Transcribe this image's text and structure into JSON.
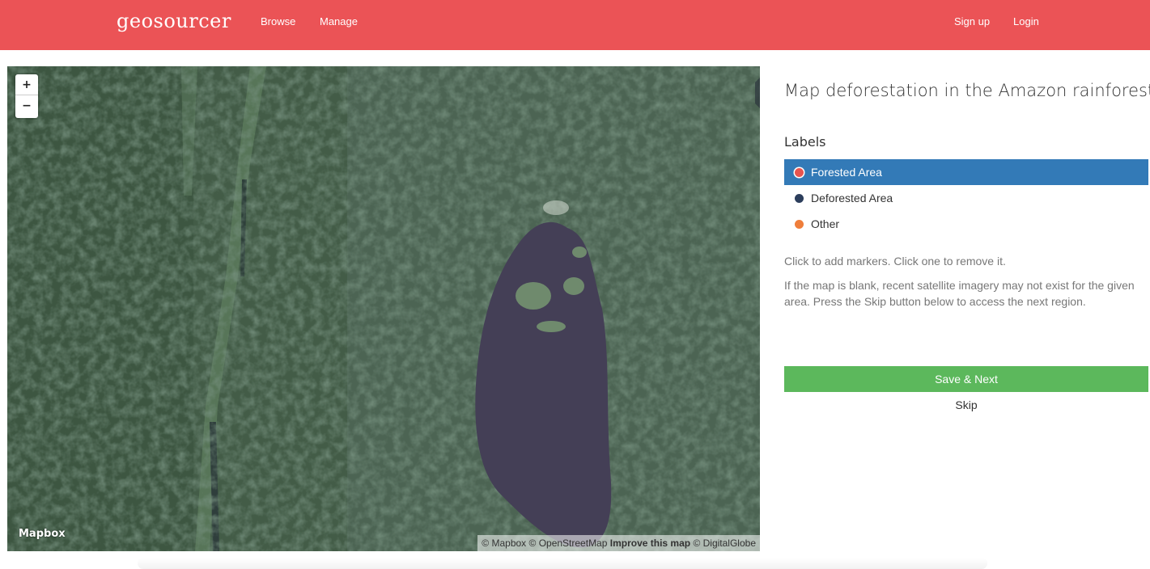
{
  "navbar": {
    "brand": "geosourcer",
    "left_links": [
      "Browse",
      "Manage"
    ],
    "right_links": [
      "Sign up",
      "Login"
    ],
    "color": "#eb5356"
  },
  "map": {
    "zoom_in": "+",
    "zoom_out": "−",
    "logo": "Mapbox",
    "attribution": {
      "mapbox": "© Mapbox",
      "osm": "© OpenStreetMap",
      "improve": "Improve this map",
      "digitalglobe": "© DigitalGlobe"
    }
  },
  "panel": {
    "title": "Map deforestation in the Amazon rainforest",
    "labels_heading": "Labels",
    "labels": [
      {
        "label": "Forested Area",
        "color": "#e8544f",
        "selected": true
      },
      {
        "label": "Deforested Area",
        "color": "#2c3e5c",
        "selected": false
      },
      {
        "label": "Other",
        "color": "#ef7e3b",
        "selected": false
      }
    ],
    "help_1": "Click to add markers. Click one to remove it.",
    "help_2": "If the map is blank, recent satellite imagery may not exist for the given area. Press the Skip button below to access the next region.",
    "save_label": "Save & Next",
    "skip_label": "Skip",
    "accent": "#337ab7",
    "save_color": "#5cb85c"
  }
}
